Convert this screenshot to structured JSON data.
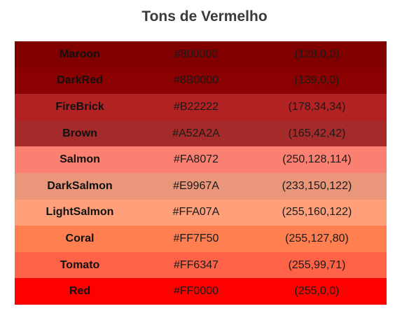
{
  "title": "Tons de Vermelho",
  "colors": [
    {
      "name": "Maroon",
      "hex": "#800000",
      "rgb": "(128,0,0)",
      "swatch": "#800000"
    },
    {
      "name": "DarkRed",
      "hex": "#8B0000",
      "rgb": "(139,0,0)",
      "swatch": "#8B0000"
    },
    {
      "name": "FireBrick",
      "hex": "#B22222",
      "rgb": "(178,34,34)",
      "swatch": "#B22222"
    },
    {
      "name": "Brown",
      "hex": "#A52A2A",
      "rgb": "(165,42,42)",
      "swatch": "#A52A2A"
    },
    {
      "name": "Salmon",
      "hex": "#FA8072",
      "rgb": "(250,128,114)",
      "swatch": "#FA8072"
    },
    {
      "name": "DarkSalmon",
      "hex": "#E9967A",
      "rgb": "(233,150,122)",
      "swatch": "#E9967A"
    },
    {
      "name": "LightSalmon",
      "hex": "#FFA07A",
      "rgb": "(255,160,122)",
      "swatch": "#FFA07A"
    },
    {
      "name": "Coral",
      "hex": "#FF7F50",
      "rgb": "(255,127,80)",
      "swatch": "#FF7F50"
    },
    {
      "name": "Tomato",
      "hex": "#FF6347",
      "rgb": "(255,99,71)",
      "swatch": "#FF6347"
    },
    {
      "name": "Red",
      "hex": "#FF0000",
      "rgb": "(255,0,0)",
      "swatch": "#FF0000"
    }
  ]
}
